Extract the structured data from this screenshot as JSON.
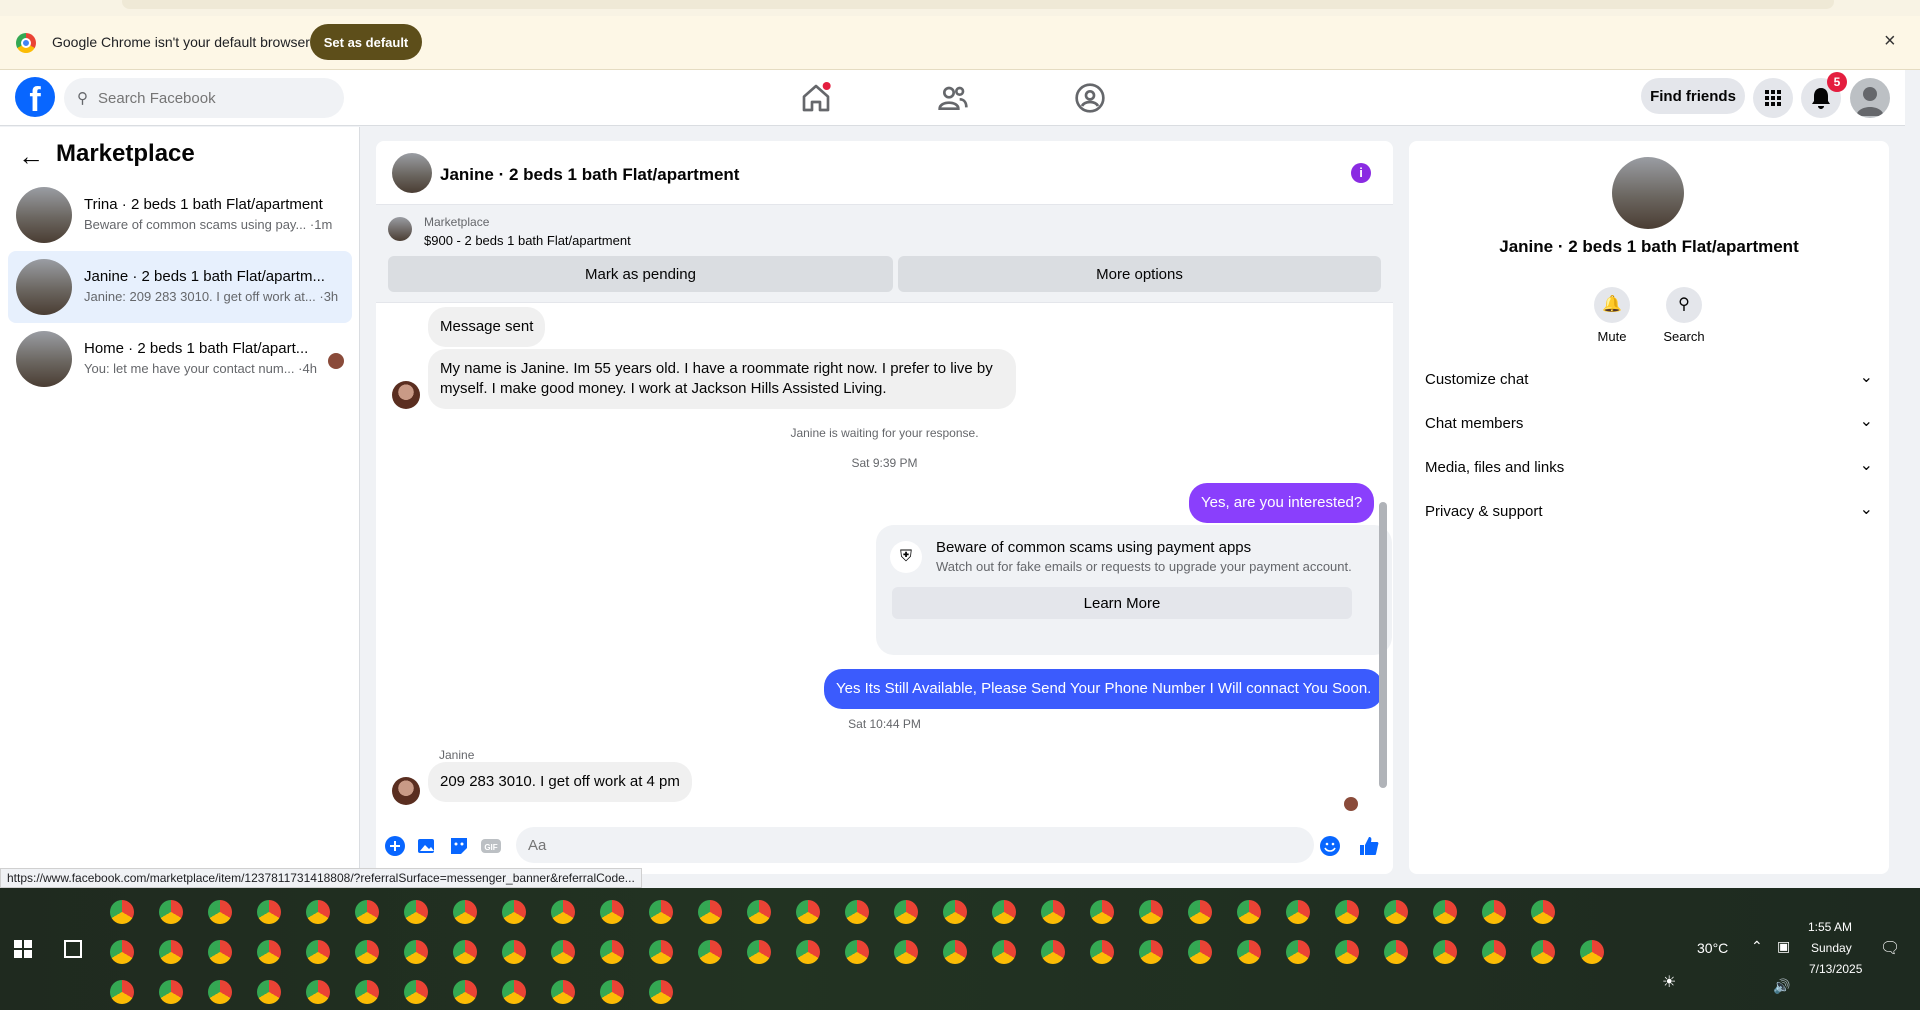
{
  "browser": {
    "infobar_message": "Google Chrome isn't your default browser",
    "set_default_label": "Set as default",
    "close_glyph": "×"
  },
  "header": {
    "search_placeholder": "Search Facebook",
    "find_friends_label": "Find friends",
    "notification_count": "5"
  },
  "sidebar": {
    "title": "Marketplace",
    "conversations": [
      {
        "name": "Trina · 2 beds 1 bath Flat/apartment",
        "preview": "Beware of common scams using pay... ·1m"
      },
      {
        "name": "Janine · 2 beds 1 bath Flat/apartm...",
        "preview": "Janine: 209 283 3010. I get off work at... ·3h"
      },
      {
        "name": "Home · 2 beds 1 bath Flat/apart...",
        "preview": "You: let me have your contact num... ·4h"
      }
    ]
  },
  "chat": {
    "title": "Janine · 2 beds 1 bath Flat/apartment",
    "listing_category": "Marketplace",
    "listing_price_title": "$900 - 2 beds 1 bath Flat/apartment",
    "mark_pending_label": "Mark as pending",
    "more_options_label": "More options",
    "messages": {
      "m1": "Message sent",
      "m2_line1": "My name is Janine. Im 55 years old. I have a roommate right now. I prefer to live by",
      "m2_line2": "myself. I make good money. I work at Jackson Hills Assisted Living.",
      "waiting": "Janine is waiting for your response.",
      "time1": "Sat 9:39 PM",
      "out1": "Yes, are you interested?",
      "scam_title": "Beware of common scams using payment apps",
      "scam_body": "Watch out for fake emails or requests to upgrade your payment account.",
      "learn_more": "Learn More",
      "out2": "Yes Its Still Available, Please Send Your Phone Number I Will connact You Soon.",
      "time2": "Sat 10:44 PM",
      "sender": "Janine",
      "in3": "209 283 3010.  I get off work at 4 pm"
    },
    "composer_placeholder": "Aa"
  },
  "info_panel": {
    "title": "Janine · 2 beds 1 bath Flat/apartment",
    "mute_label": "Mute",
    "search_label": "Search",
    "rows": [
      "Customize chat",
      "Chat members",
      "Media, files and links",
      "Privacy & support"
    ]
  },
  "status_url": "https://www.facebook.com/marketplace/item/1237811731418808/?referralSurface=messenger_banner&referralCode...",
  "taskbar": {
    "temperature": "30°C",
    "time": "1:55 AM",
    "day": "Sunday",
    "date": "7/13/2025"
  },
  "colors": {
    "fb_blue": "#0866ff",
    "out_bubble_purple": "#8a3ffc",
    "out_bubble_blue": "#3b5bfd",
    "notification_red": "#e41e3f"
  }
}
